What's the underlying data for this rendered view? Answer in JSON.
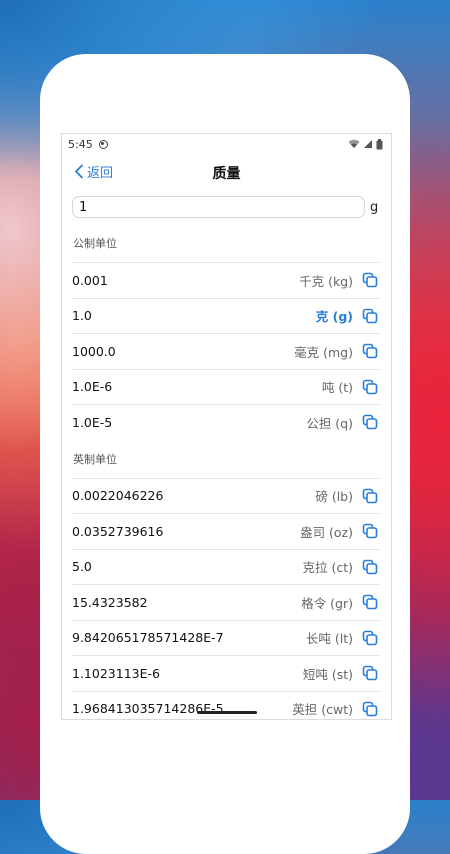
{
  "status": {
    "time": "5:45"
  },
  "nav": {
    "back_label": "返回",
    "title": "质量"
  },
  "input": {
    "value": "1",
    "unit": "g"
  },
  "sections": [
    {
      "header": "公制单位",
      "rows": [
        {
          "value": "0.001",
          "unit": "千克 (kg)",
          "active": false
        },
        {
          "value": "1.0",
          "unit": "克 (g)",
          "active": true
        },
        {
          "value": "1000.0",
          "unit": "毫克 (mg)",
          "active": false
        },
        {
          "value": "1.0E-6",
          "unit": "吨 (t)",
          "active": false
        },
        {
          "value": "1.0E-5",
          "unit": "公担 (q)",
          "active": false
        }
      ]
    },
    {
      "header": "英制单位",
      "rows": [
        {
          "value": "0.0022046226",
          "unit": "磅 (lb)",
          "active": false
        },
        {
          "value": "0.0352739616",
          "unit": "盎司 (oz)",
          "active": false
        },
        {
          "value": "5.0",
          "unit": "克拉 (ct)",
          "active": false
        },
        {
          "value": "15.4323582",
          "unit": "格令 (gr)",
          "active": false
        },
        {
          "value": "9.842065178571428E-7",
          "unit": "长吨 (lt)",
          "active": false
        },
        {
          "value": "1.1023113E-6",
          "unit": "短吨 (st)",
          "active": false
        },
        {
          "value": "1.968413035714286E-5",
          "unit": "英担 (cwt)",
          "active": false
        }
      ]
    }
  ],
  "colors": {
    "accent": "#2a7ed8"
  },
  "icons": {
    "back": "chevron-left-icon",
    "copy": "copy-icon"
  }
}
